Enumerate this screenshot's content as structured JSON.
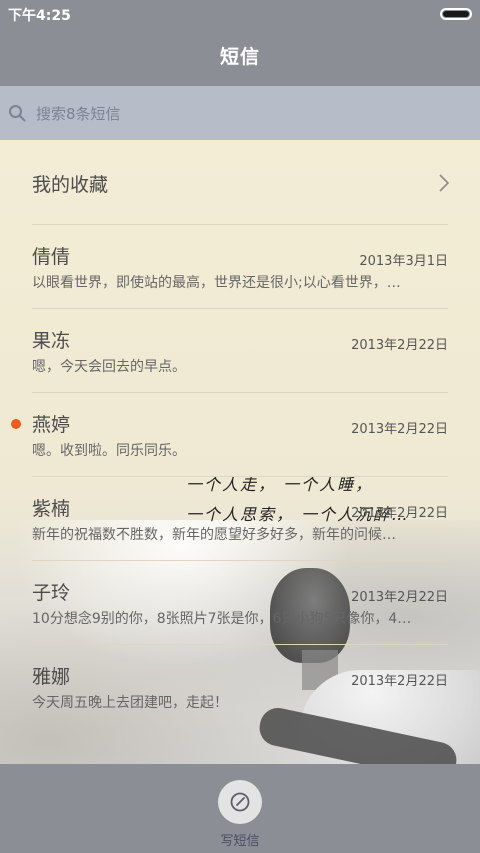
{
  "status_bar": {
    "time": "下午4:25"
  },
  "header": {
    "title": "短信"
  },
  "search": {
    "placeholder": "搜索8条短信"
  },
  "favorites": {
    "label": "我的收藏"
  },
  "conversations": [
    {
      "name": "倩倩",
      "date": "2013年3月1日",
      "preview": "以眼看世界，即使站的最高，世界还是很小;以心看世界，…",
      "unread": false
    },
    {
      "name": "果冻",
      "date": "2013年2月22日",
      "preview": "嗯，今天会回去的早点。",
      "unread": false
    },
    {
      "name": "燕婷",
      "date": "2013年2月22日",
      "preview": "嗯。收到啦。同乐同乐。",
      "unread": true
    },
    {
      "name": "紫楠",
      "date": "2013年2月22日",
      "preview": "新年的祝福数不胜数，新年的愿望好多好多，新年的问候…",
      "unread": false
    },
    {
      "name": "子玲",
      "date": "2013年2月22日",
      "preview": "10分想念9别的你，8张照片7张是你，6只小狗5只像你，4…",
      "unread": false
    },
    {
      "name": "雅娜",
      "date": "2013年2月22日",
      "preview": "今天周五晚上去团建吧，走起！",
      "unread": false
    }
  ],
  "wallpaper": {
    "handwriting_line1": "一个人走， 一个人睡，",
    "handwriting_line2": "一个人思索， 一个人沉醉…"
  },
  "bottom_bar": {
    "compose_label": "写短信"
  },
  "colors": {
    "bar_gray": "#8c8e95",
    "search_bar": "#b7bcc9",
    "unread_dot": "#f05a1e",
    "list_background": "#f2ecd6"
  }
}
